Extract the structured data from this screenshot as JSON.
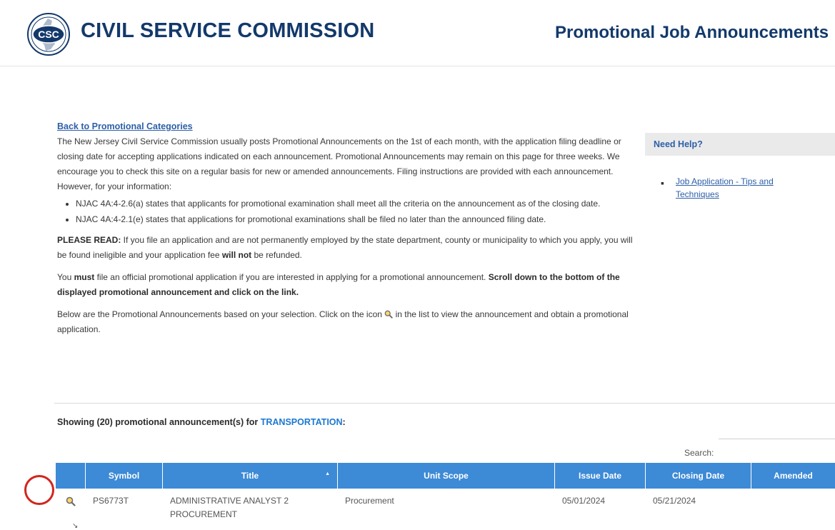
{
  "header": {
    "seal_text": "CSC",
    "brand": "CIVIL SERVICE COMMISSION",
    "page_heading": "Promotional Job Announcements"
  },
  "back_link": "Back to Promotional Categories",
  "content": {
    "intro": "The New Jersey Civil Service Commission usually posts Promotional Announcements on the 1st of each month, with the application filing deadline or closing date for accepting applications indicated on each announcement. Promotional Announcements may remain on this page for three weeks. We encourage you to check this site on a regular basis for new or amended announcements. Filing instructions are provided with each announcement. However, for your information:",
    "bullets": [
      "NJAC 4A:4-2.6(a) states that applicants for promotional examination shall meet all the criteria on the announcement as of the closing date.",
      "NJAC 4A:4-2.1(e) states that applications for promotional examinations shall be filed no later than the announced filing date."
    ],
    "read_label": "PLEASE READ:",
    "read_text_1": " If you file an application and are not permanently employed by the state department, county or municipality to which you apply, you will be found ineligible and your application fee ",
    "read_bold": "will not",
    "read_text_2": " be refunded.",
    "must_text_1": "You ",
    "must_bold": "must",
    "must_text_2": " file an official promotional application if you are interested in applying for a promotional announcement. ",
    "must_bold_2": "Scroll down to the bottom of the displayed promotional announcement and click on the link.",
    "below_text_1": "Below are the Promotional Announcements based on your selection. Click on the icon ",
    "below_text_2": " in the list to view the announcement and obtain a promotional application."
  },
  "help": {
    "title": "Need Help?",
    "link": "Job Application - Tips and Techniques"
  },
  "listing": {
    "showing_prefix": "Showing (20) promotional announcement(s) for ",
    "category": "TRANSPORTATION",
    "showing_suffix": ":"
  },
  "search": {
    "label": "Search:",
    "value": ""
  },
  "table": {
    "columns": [
      "",
      "Symbol",
      "Title",
      "Unit Scope",
      "Issue Date",
      "Closing Date",
      "Amended"
    ],
    "rows": [
      {
        "symbol": "PS6773T",
        "title": "ADMINISTRATIVE ANALYST 2 PROCUREMENT",
        "unit_scope": "Procurement",
        "issue_date": "05/01/2024",
        "closing_date": "05/21/2024",
        "amended": ""
      }
    ]
  },
  "colors": {
    "brand_navy": "#13396b",
    "link_blue": "#2d5fa8",
    "table_header": "#3d8ad6",
    "highlight_red": "#d2261e",
    "category_blue": "#1b78d0"
  },
  "icons": [
    "csc-seal-icon",
    "magnifier-icon"
  ]
}
